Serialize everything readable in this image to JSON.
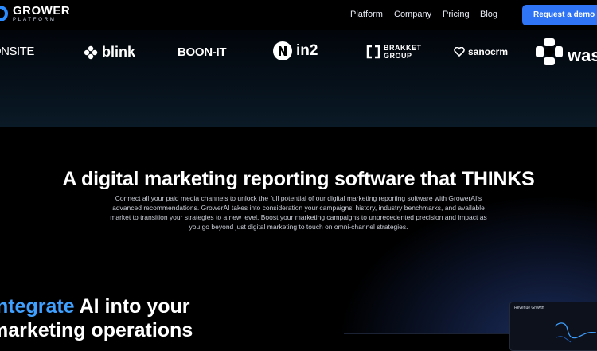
{
  "header": {
    "logo": {
      "name": "GROWER",
      "sub": "PLATFORM"
    },
    "nav": [
      "Platform",
      "Company",
      "Pricing",
      "Blog"
    ],
    "cta": "Request a demo"
  },
  "clients": [
    "ONSITE",
    "blink",
    "BOON-IT",
    "in2",
    "BRAKKET GROUP",
    "sanocrm",
    "wasl"
  ],
  "main": {
    "headline": "A digital marketing reporting software that THINKS",
    "paragraph": "Connect all your  paid media channels to unlock the full potential of our digital marketing reporting software with GrowerAI's advanced recommendations. GrowerAI takes into consideration your campaigns' history, industry benchmarks, and available market to transition your strategies to a new level. Boost your marketing campaigns to unprecedented precision and impact as you go beyond just digital marketing to touch on omni-channel strategies.",
    "integrate": {
      "highlight": "Integrate",
      "rest": " AI into your",
      "line2": "marketing operations"
    },
    "card_title": "Revenue Growth"
  },
  "colors": {
    "accent": "#2f74f5",
    "highlight": "#3fa0ff",
    "background": "#000000"
  }
}
